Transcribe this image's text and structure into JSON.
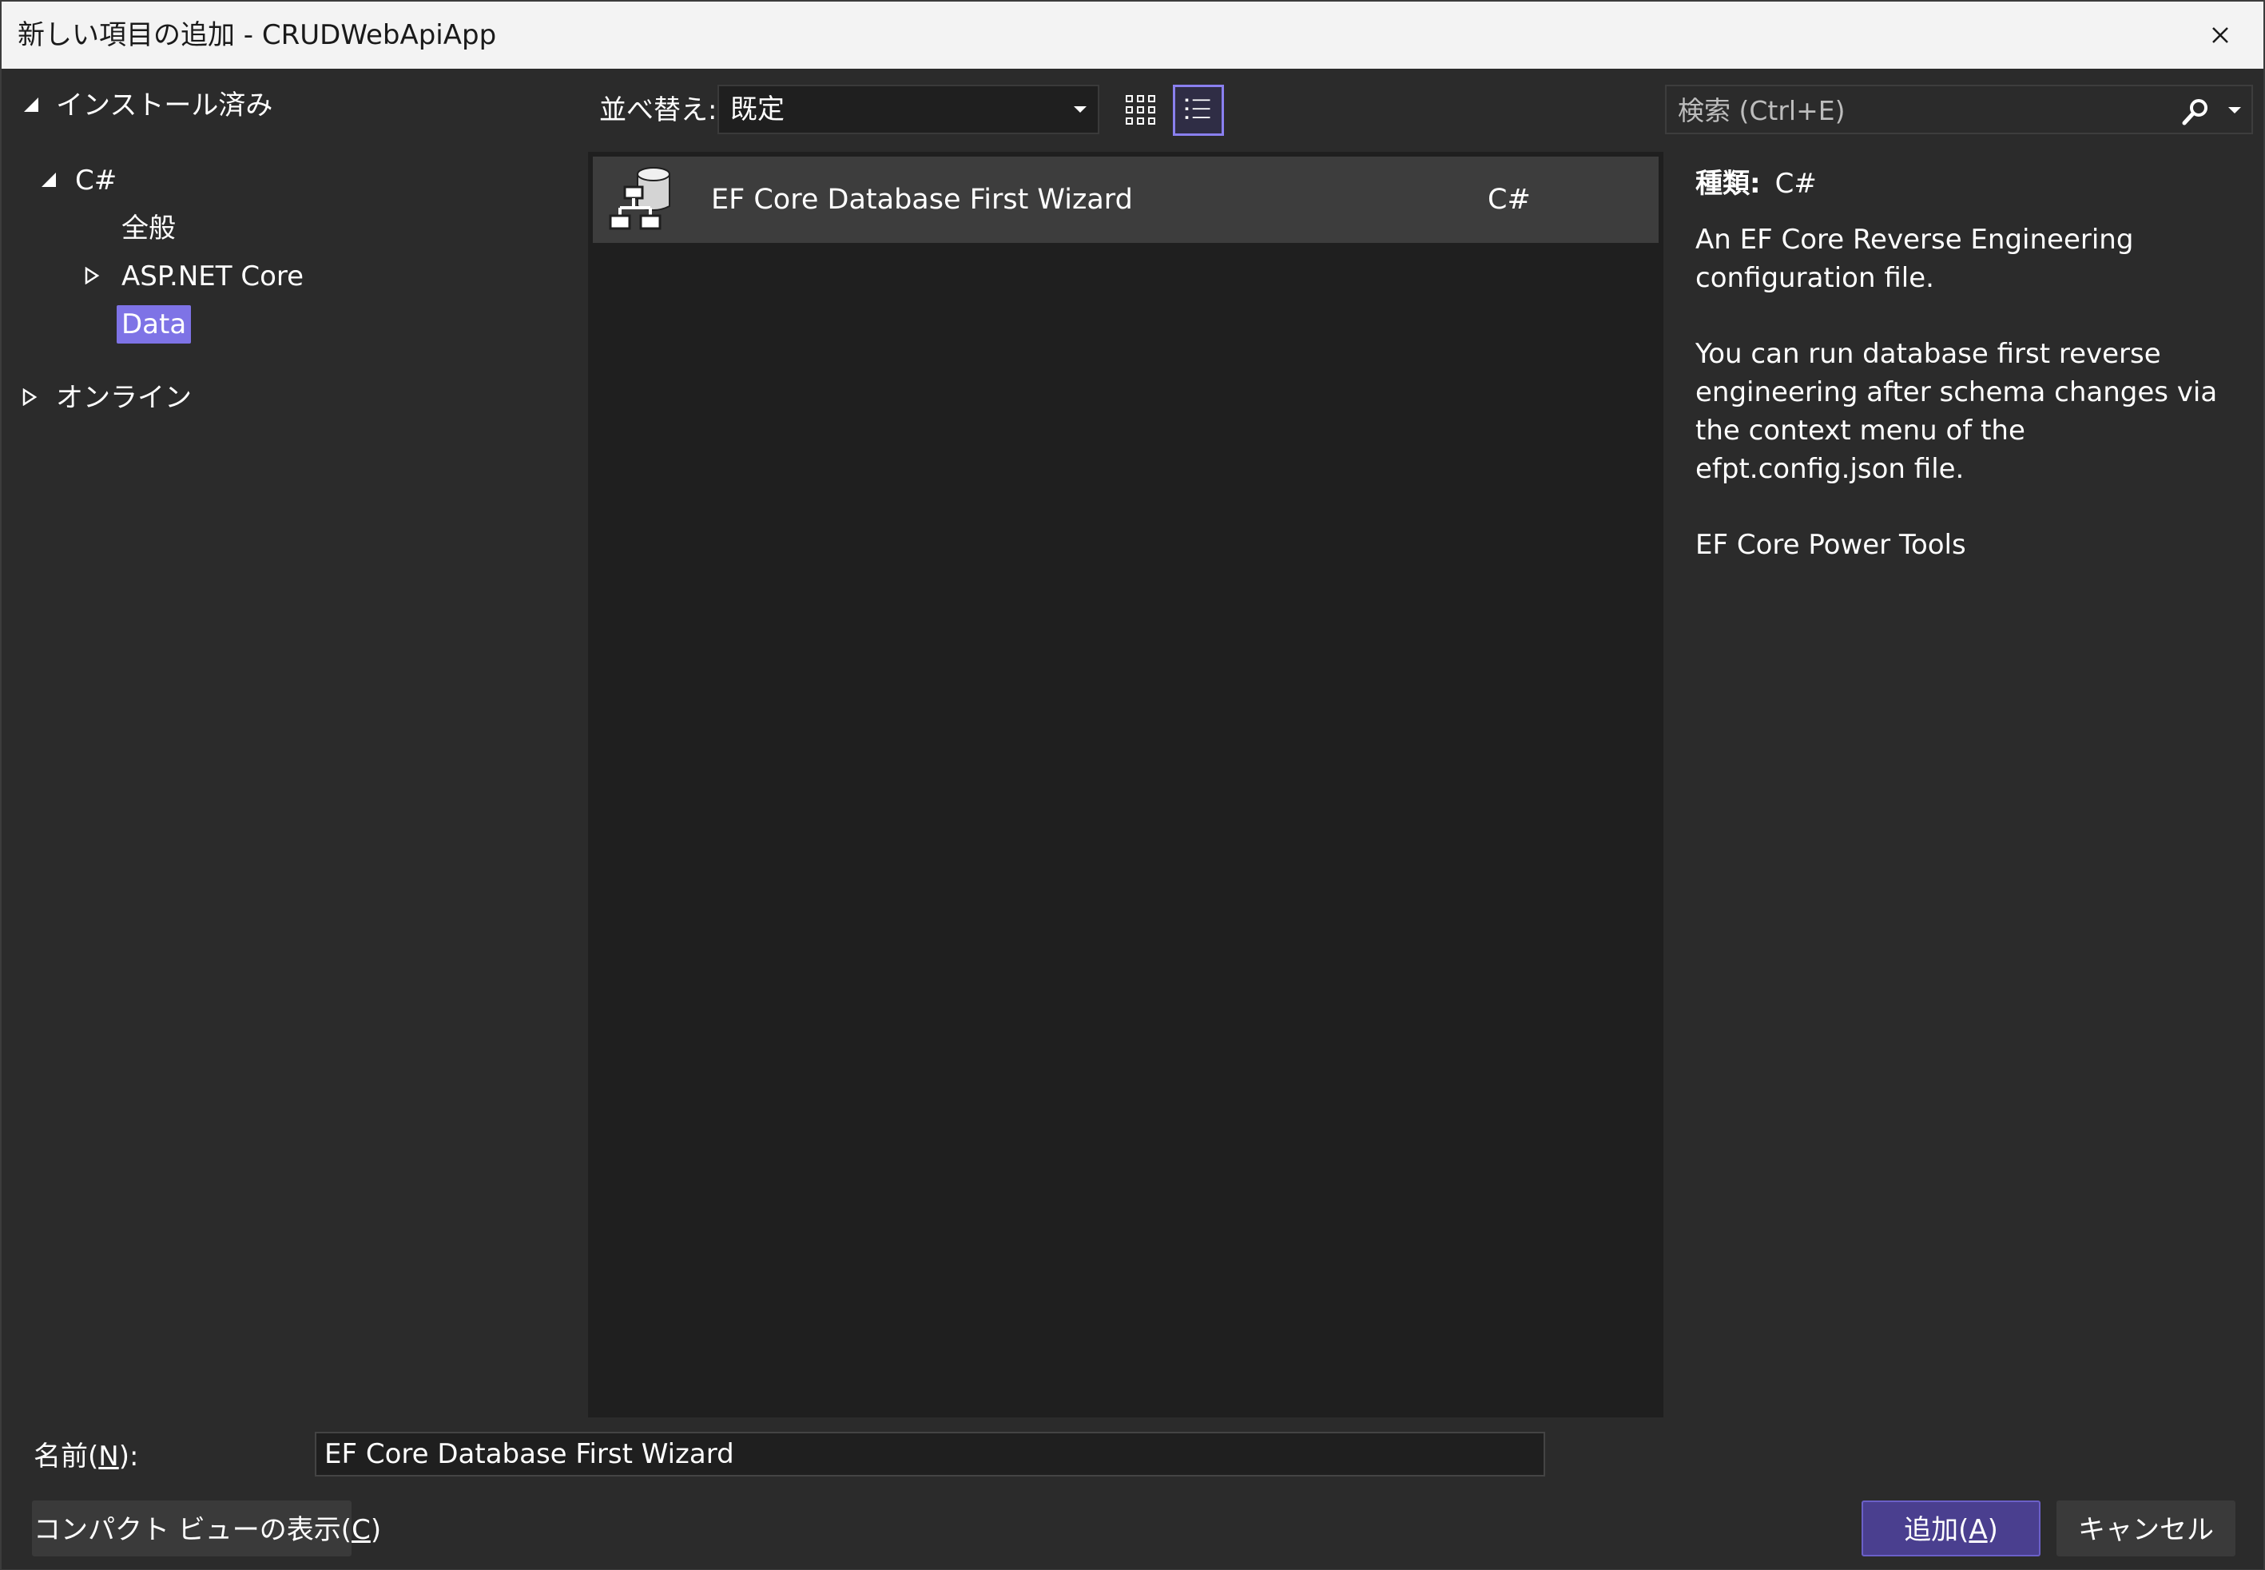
{
  "window": {
    "title": "新しい項目の追加 - CRUDWebApiApp"
  },
  "tree": {
    "installed": "インストール済み",
    "csharp": "C#",
    "general": "全般",
    "aspnet_core": "ASP.NET Core",
    "data": "Data",
    "online": "オンライン"
  },
  "toolbar": {
    "sort_label": "並べ替え:",
    "sort_value": "既定"
  },
  "search": {
    "placeholder": "検索 (Ctrl+E)"
  },
  "templates": [
    {
      "name": "EF Core Database First Wizard",
      "language": "C#",
      "icon": "database-schema-icon"
    }
  ],
  "details": {
    "type_key": "種類:",
    "type_value": "C#",
    "description_1": "An EF Core Reverse Engineering configuration file.",
    "description_2": "You can run database first reverse engineering after schema changes via the context menu of the efpt.config.json file.",
    "author": "EF Core Power Tools"
  },
  "footer": {
    "name_label_prefix": "名前(",
    "name_label_key": "N",
    "name_label_suffix": "):",
    "name_value": "EF Core Database First Wizard",
    "compact_prefix": "コンパクト ビューの表示(",
    "compact_key": "C",
    "compact_suffix": ")",
    "add_prefix": "追加(",
    "add_key": "A",
    "add_suffix": ")",
    "cancel_label": "キャンセル"
  },
  "colors": {
    "accent": "#7e73e6",
    "primary_button": "#4a3f8f",
    "background": "#2b2b2b",
    "list_background": "#1f1f1f"
  }
}
